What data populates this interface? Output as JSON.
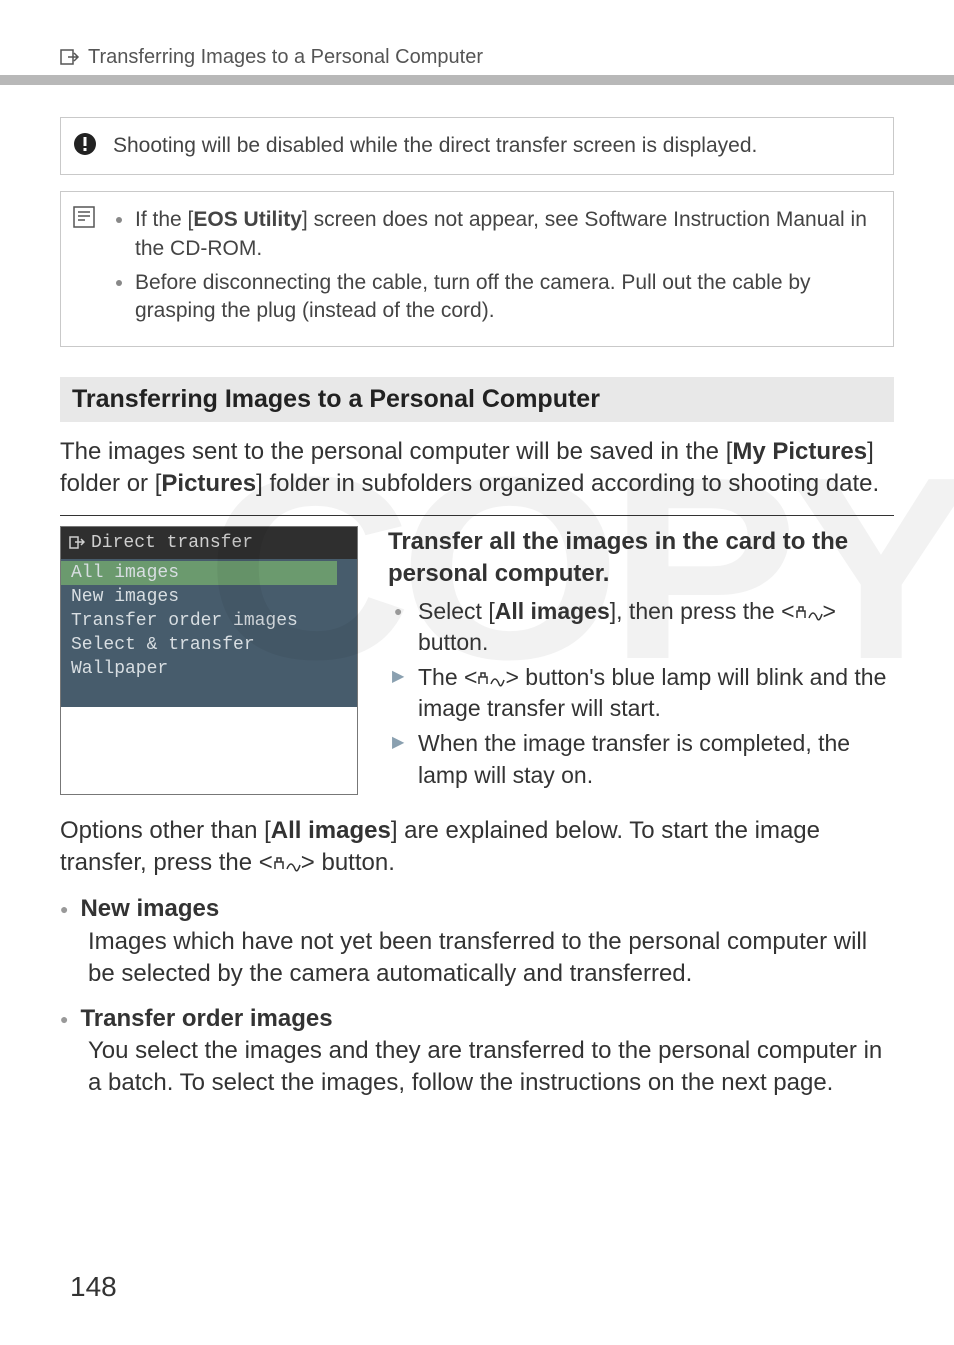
{
  "header": {
    "title": "Transferring Images to a Personal Computer"
  },
  "caution": {
    "text": "Shooting will be disabled while the direct transfer screen is displayed."
  },
  "notes": {
    "item1_prefix": "If the [",
    "item1_bold": "EOS Utility",
    "item1_suffix": "] screen does not appear, see Software Instruction Manual in the CD-ROM.",
    "item2": "Before disconnecting the cable, turn off the camera. Pull out the cable by grasping the plug (instead of the cord)."
  },
  "subheading": "Transferring Images to a Personal Computer",
  "intro": {
    "p1_a": "The images sent to the personal computer will be saved in the [",
    "p1_b": "My Pictures",
    "p1_c": "] folder or [",
    "p1_d": "Pictures",
    "p1_e": "] folder in subfolders organized according to shooting date."
  },
  "screenshot": {
    "title": "Direct transfer",
    "items": [
      "All images",
      "New images",
      "Transfer order images",
      "Select & transfer",
      "Wallpaper"
    ]
  },
  "step": {
    "title": "Transfer all the images in the card to the personal computer.",
    "b1_a": "Select [",
    "b1_b": "All images",
    "b1_c": "], then press the <",
    "b1_d": "> button.",
    "b2_a": "The <",
    "b2_b": "> button's blue lamp will blink and the image transfer will start.",
    "b3": "When the image transfer is completed, the lamp will stay on."
  },
  "options_intro": {
    "a": "Options other than [",
    "b": "All images",
    "c": "] are explained below. To start the image transfer, press the <",
    "d": "> button."
  },
  "opt1": {
    "title": "New images",
    "body": "Images which have not yet been transferred to the personal computer will be selected by the camera automatically and transferred."
  },
  "opt2": {
    "title": "Transfer order images",
    "body": "You select the images and they are transferred to the personal computer in a batch. To select the images, follow the instructions on the next page."
  },
  "page_number": "148"
}
